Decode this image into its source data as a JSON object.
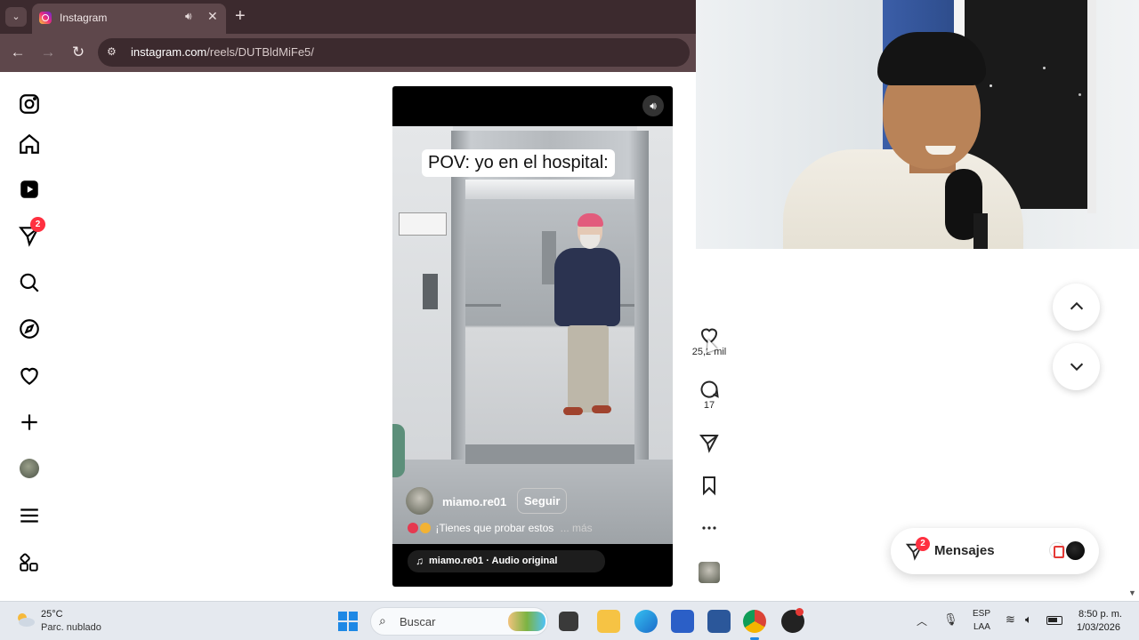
{
  "browser": {
    "tab_title": "Instagram",
    "url_host": "instagram.com",
    "url_path": "/reels/DUTBldMiFe5/"
  },
  "sidenav": {
    "items": [
      {
        "name": "instagram-logo-icon"
      },
      {
        "name": "home-icon"
      },
      {
        "name": "reels-icon"
      },
      {
        "name": "messages-icon",
        "badge": "2"
      },
      {
        "name": "search-icon"
      },
      {
        "name": "explore-icon"
      },
      {
        "name": "notifications-icon"
      },
      {
        "name": "create-icon"
      },
      {
        "name": "profile-avatar"
      },
      {
        "name": "more-menu-icon"
      },
      {
        "name": "also-from-meta-icon"
      }
    ]
  },
  "reel": {
    "caption_overlay": "POV: yo en el hospital:",
    "author": "miamo.re01",
    "follow_label": "Seguir",
    "description": "¡Tienes que probar estos",
    "more_label": "... más",
    "audio": "miamo.re01 · Audio original"
  },
  "actions": {
    "likes": "25,2 mil",
    "comments": "17"
  },
  "messages": {
    "label": "Mensajes",
    "badge": "2"
  },
  "taskbar": {
    "temperature": "25°C",
    "weather": "Parc. nublado",
    "search_placeholder": "Buscar",
    "lang_1": "ESP",
    "lang_2": "LAA",
    "time": "8:50 p. m.",
    "date": "1/03/2026"
  },
  "colors": {
    "chrome_dark": "#3c2a2e",
    "chrome_mid": "#5e474b",
    "badge_red": "#ff3040",
    "taskbar": "#e5e9ef"
  }
}
